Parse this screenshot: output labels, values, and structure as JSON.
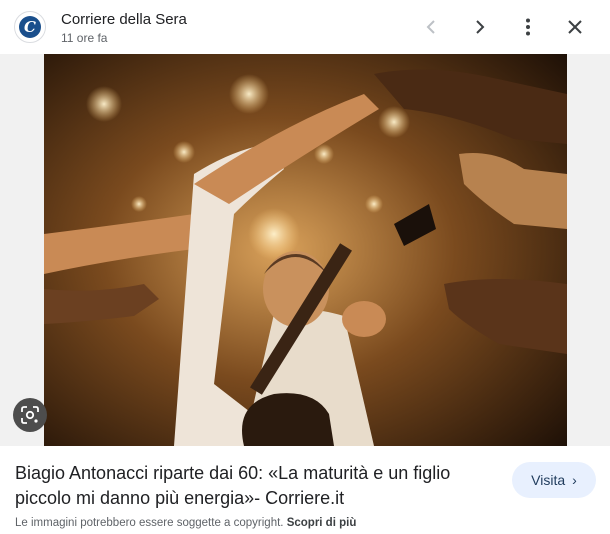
{
  "header": {
    "source_name": "Corriere della Sera",
    "time_ago": "11 ore fa",
    "favicon_letter": "C",
    "icons": [
      "previous-icon",
      "next-icon",
      "more-vert-icon",
      "close-icon"
    ]
  },
  "image": {
    "alt": "Biagio Antonacci"
  },
  "caption": {
    "title": "Biagio Antonacci riparte dai 60: «La maturità e un figlio piccolo mi danno più energia»- Corriere.it"
  },
  "visit": {
    "label": "Visita",
    "chevron": "›"
  },
  "footer": {
    "copyright_text": "Le immagini potrebbero essere soggette a copyright.",
    "learn_more": "Scopri di più"
  },
  "colors": {
    "accent_button_bg": "#e8f0fe",
    "text_primary": "#202124",
    "text_secondary": "#5f6368"
  }
}
